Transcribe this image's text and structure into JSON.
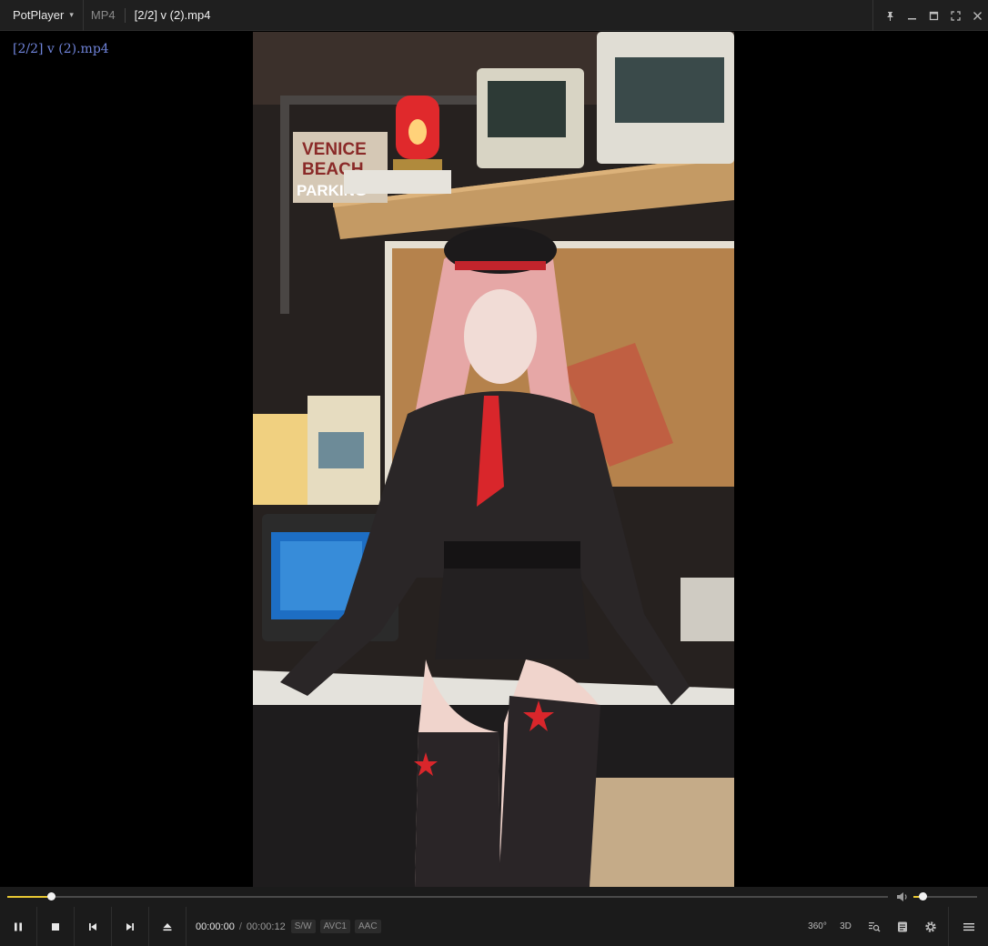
{
  "titlebar": {
    "app_name": "PotPlayer",
    "format": "MP4",
    "title": "[2/2] v (2).mp4"
  },
  "osd": {
    "text": "[2/2] v (2).mp4"
  },
  "playback": {
    "current_time": "00:00:00",
    "duration": "00:00:12",
    "progress_fraction": 0.05,
    "volume_fraction": 0.14
  },
  "badges": {
    "decoder": "S/W",
    "video_codec": "AVC1",
    "audio_codec": "AAC"
  },
  "right_controls": {
    "vr_label": "360°",
    "stereo_label": "3D"
  },
  "icons": {
    "menu": "chevron-down-icon",
    "pin": "pin-icon",
    "minimize": "minimize-icon",
    "maximize": "maximize-icon",
    "fullscreen": "fullscreen-icon",
    "close": "close-icon",
    "pause": "pause-icon",
    "stop": "stop-icon",
    "previous": "previous-icon",
    "next": "next-icon",
    "eject": "eject-icon",
    "volume": "volume-icon",
    "playlist_search": "playlist-search-icon",
    "chapter": "chapter-icon",
    "settings": "gear-icon",
    "main_menu": "hamburger-icon"
  },
  "colors": {
    "accent": "#e8c833",
    "osd_text": "#6f83d9"
  }
}
